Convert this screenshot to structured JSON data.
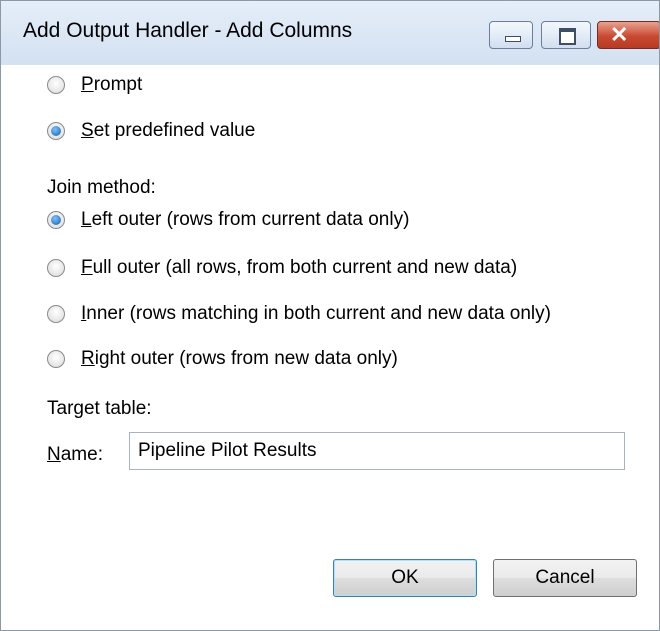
{
  "window": {
    "title": "Add Output Handler - Add Columns"
  },
  "mode": {
    "prompt": {
      "accel": "P",
      "rest": "rompt",
      "checked": false
    },
    "predefined": {
      "accel": "S",
      "rest": "et predefined value",
      "checked": true
    }
  },
  "join": {
    "heading": "Join method:",
    "left": {
      "accel": "L",
      "rest": "eft outer (rows from current data only)",
      "checked": true
    },
    "full": {
      "accel": "F",
      "rest": "ull outer (all rows, from both current and new data)",
      "checked": false
    },
    "inner": {
      "accel": "I",
      "rest": "nner (rows matching in both current and new data only)",
      "checked": false
    },
    "right": {
      "accel": "R",
      "rest": "ight outer (rows from new data only)",
      "checked": false
    }
  },
  "target": {
    "heading": "Target table:",
    "name_accel": "N",
    "name_rest": "ame:",
    "name_value": "Pipeline Pilot Results"
  },
  "buttons": {
    "ok": "OK",
    "cancel": "Cancel"
  }
}
